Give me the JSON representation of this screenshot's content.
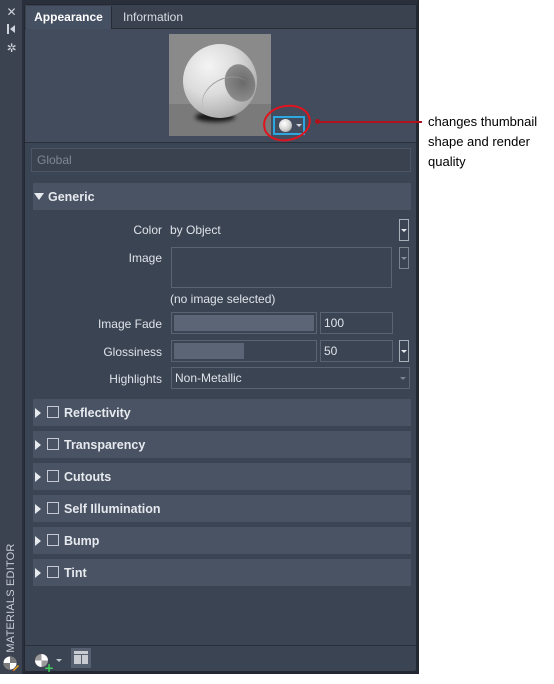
{
  "side_strip": {
    "buttons": [
      {
        "name": "close",
        "glyph": "✕"
      },
      {
        "name": "auto-hide",
        "glyph": "⇥"
      },
      {
        "name": "properties",
        "glyph": "✲"
      }
    ],
    "title": "MATERIALS EDITOR"
  },
  "tabs": [
    {
      "label": "Appearance",
      "active": true
    },
    {
      "label": "Information",
      "active": false
    }
  ],
  "preview": {
    "thumbnail_alt": "material preview sphere",
    "shape_button": "thumbnail shape and render quality"
  },
  "global_field": {
    "value": "Global"
  },
  "generic": {
    "title": "Generic",
    "expanded": true,
    "properties": {
      "color": {
        "label": "Color",
        "value": "by Object"
      },
      "image": {
        "label": "Image",
        "note": "(no image selected)"
      },
      "image_fade": {
        "label": "Image Fade",
        "value": "100",
        "fraction": 1.0
      },
      "glossiness": {
        "label": "Glossiness",
        "value": "50",
        "fraction": 0.5
      },
      "highlights": {
        "label": "Highlights",
        "value": "Non-Metallic"
      }
    }
  },
  "sections": [
    {
      "title": "Reflectivity",
      "checked": false
    },
    {
      "title": "Transparency",
      "checked": false
    },
    {
      "title": "Cutouts",
      "checked": false
    },
    {
      "title": "Self Illumination",
      "checked": false
    },
    {
      "title": "Bump",
      "checked": false
    },
    {
      "title": "Tint",
      "checked": false
    }
  ],
  "footer": {
    "create_material": "Create Material",
    "browser_layout": "Material Browser"
  },
  "callout": {
    "text": "changes thumbnail shape and render quality",
    "color": "#b0121b"
  },
  "colors": {
    "highlight_border": "#2ea6e0",
    "annotation_red": "#e0141e",
    "panel_bg": "#3b4452",
    "section_bg": "#4a5363"
  }
}
